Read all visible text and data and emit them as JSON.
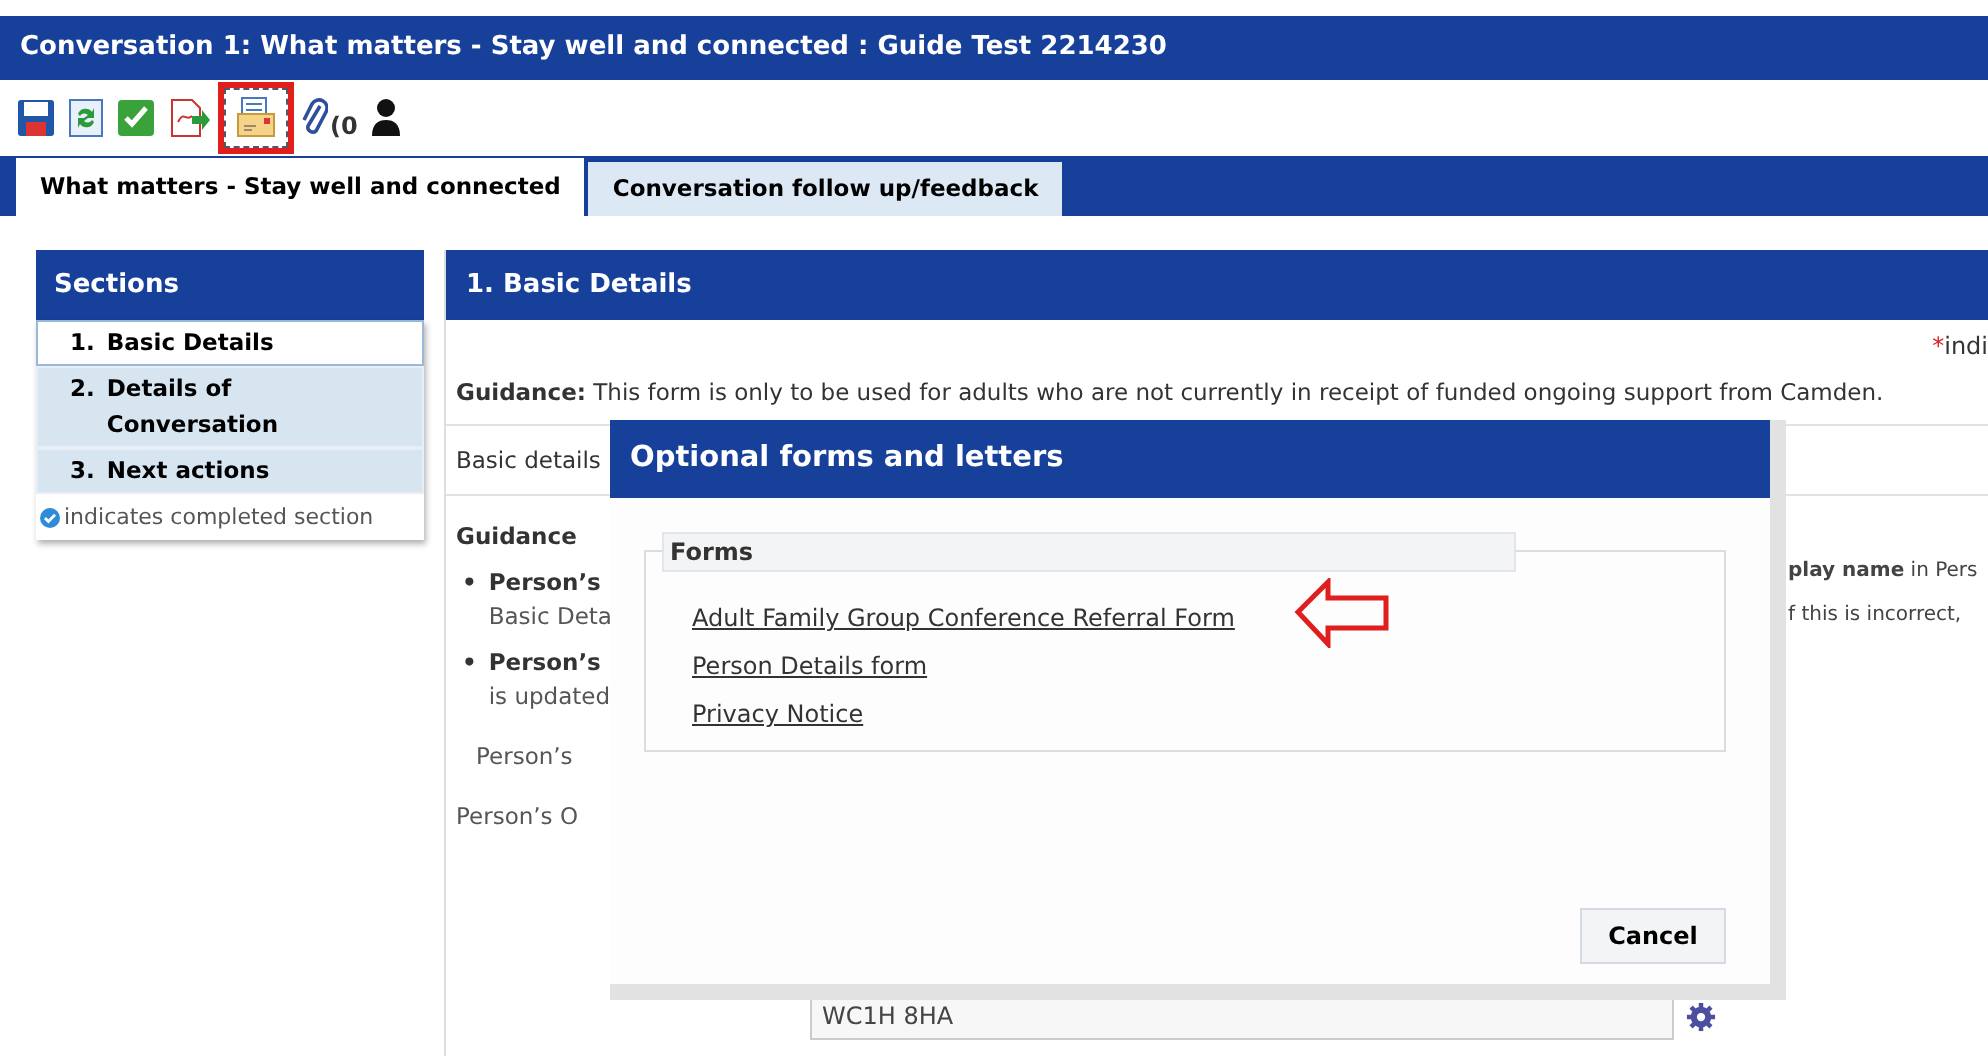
{
  "window": {
    "title": "Conversation 1: What matters - Stay well and connected :  Guide Test  2214230"
  },
  "toolbar": [
    {
      "kind": "save",
      "highlighted": false
    },
    {
      "kind": "refresh",
      "highlighted": false
    },
    {
      "kind": "check",
      "highlighted": false
    },
    {
      "kind": "export",
      "highlighted": false
    },
    {
      "kind": "forms",
      "highlighted": true
    },
    {
      "kind": "attach",
      "highlighted": false,
      "count": "(0"
    },
    {
      "kind": "person",
      "highlighted": false
    }
  ],
  "tabs": [
    {
      "label": "What matters - Stay well and connected",
      "selected": true
    },
    {
      "label": "Conversation follow up/feedback",
      "selected": false
    }
  ],
  "sections": {
    "title": "Sections",
    "items": [
      {
        "number": "1.",
        "label": "Basic Details",
        "selected": true
      },
      {
        "number": "2.",
        "label": "Details of Conversation",
        "selected": false
      },
      {
        "number": "3.",
        "label": "Next actions",
        "selected": false
      }
    ],
    "legend": "indicates completed section"
  },
  "main": {
    "title": "1. Basic Details",
    "required_mark": "*",
    "required_note": "indi",
    "guidance": "**Guidance:** This form is only to be used for adults who are not currently in receipt of funded ongoing support from Camden.",
    "subheading": "Basic details",
    "guidance_heading": "Guidance",
    "bullets": [
      {
        "marker": "•",
        "bold": "Person’s",
        "rest": "Basic Deta"
      },
      {
        "marker": "•",
        "bold": "Person’s",
        "rest": "is updated"
      }
    ],
    "labels": [
      "Person’s",
      "Person’s O"
    ],
    "right_texts": [
      "**play name** in Pers",
      "f this is incorrect,"
    ],
    "postcode": "WC1H 8HA"
  },
  "dialog": {
    "title": "Optional forms and letters",
    "group": "Forms",
    "links": [
      "Adult Family Group Conference Referral Form",
      "Person Details form",
      "Privacy Notice"
    ],
    "cancel": "Cancel"
  }
}
